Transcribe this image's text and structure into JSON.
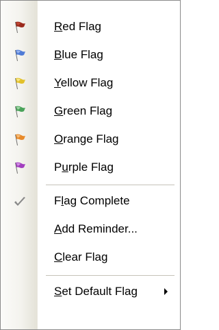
{
  "menu": {
    "items": [
      {
        "label": "Red Flag",
        "mnemonic": "R",
        "icon": "red-flag-icon",
        "color": "#9b2a1c"
      },
      {
        "label": "Blue Flag",
        "mnemonic": "B",
        "icon": "blue-flag-icon",
        "color": "#4f7bd6"
      },
      {
        "label": "Yellow Flag",
        "mnemonic": "Y",
        "icon": "yellow-flag-icon",
        "color": "#e2c12a"
      },
      {
        "label": "Green Flag",
        "mnemonic": "G",
        "icon": "green-flag-icon",
        "color": "#4aa35a"
      },
      {
        "label": "Orange Flag",
        "mnemonic": "O",
        "icon": "orange-flag-icon",
        "color": "#e88a2a"
      },
      {
        "label": "Purple Flag",
        "mnemonic": "u",
        "icon": "purple-flag-icon",
        "color": "#a23fbf"
      },
      {
        "label": "Flag Complete",
        "mnemonic": "l",
        "icon": "checkmark-icon",
        "color": "#8a8a8a"
      },
      {
        "label": "Add Reminder...",
        "mnemonic": "A",
        "icon": null
      },
      {
        "label": "Clear Flag",
        "mnemonic": "C",
        "icon": null
      },
      {
        "label": "Set Default Flag",
        "mnemonic": "S",
        "icon": null,
        "submenu": true
      }
    ]
  }
}
